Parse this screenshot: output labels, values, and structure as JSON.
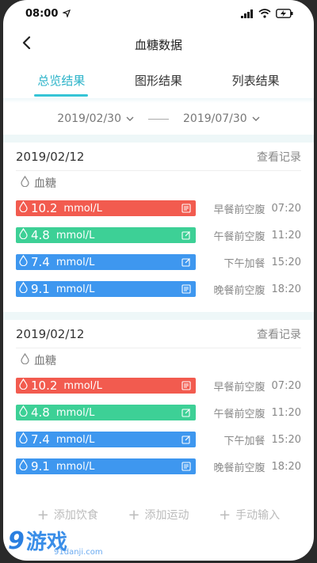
{
  "status": {
    "time": "08:00"
  },
  "nav": {
    "title": "血糖数据"
  },
  "tabs": [
    {
      "label": "总览结果",
      "active": true
    },
    {
      "label": "图形结果",
      "active": false
    },
    {
      "label": "列表结果",
      "active": false
    }
  ],
  "date_range": {
    "start": "2019/02/30",
    "end": "2019/07/30"
  },
  "cards": [
    {
      "date": "2019/02/12",
      "view_label": "查看记录",
      "category": "血糖",
      "readings": [
        {
          "value": "10.2",
          "unit": "mmol/L",
          "color": "#f25b4f",
          "action_icon": "document-icon",
          "meal": "早餐前空腹",
          "time": "07:20"
        },
        {
          "value": "4.8",
          "unit": "mmol/L",
          "color": "#3dd096",
          "action_icon": "edit-icon",
          "meal": "午餐前空腹",
          "time": "11:20"
        },
        {
          "value": "7.4",
          "unit": "mmol/L",
          "color": "#3e97ef",
          "action_icon": "edit-icon",
          "meal": "下午加餐",
          "time": "15:20"
        },
        {
          "value": "9.1",
          "unit": "mmol/L",
          "color": "#3e97ef",
          "action_icon": "document-icon",
          "meal": "晚餐前空腹",
          "time": "18:20"
        }
      ]
    },
    {
      "date": "2019/02/12",
      "view_label": "查看记录",
      "category": "血糖",
      "readings": [
        {
          "value": "10.2",
          "unit": "mmol/L",
          "color": "#f25b4f",
          "action_icon": "document-icon",
          "meal": "早餐前空腹",
          "time": "07:20"
        },
        {
          "value": "4.8",
          "unit": "mmol/L",
          "color": "#3dd096",
          "action_icon": "edit-icon",
          "meal": "午餐前空腹",
          "time": "11:20"
        },
        {
          "value": "7.4",
          "unit": "mmol/L",
          "color": "#3e97ef",
          "action_icon": "edit-icon",
          "meal": "下午加餐",
          "time": "15:20"
        },
        {
          "value": "9.1",
          "unit": "mmol/L",
          "color": "#3e97ef",
          "action_icon": "document-icon",
          "meal": "晚餐前空腹",
          "time": "18:20"
        }
      ]
    }
  ],
  "bottom_actions": [
    {
      "label": "添加饮食"
    },
    {
      "label": "添加运动"
    },
    {
      "label": "手动输入"
    }
  ],
  "watermark": {
    "logo": "9",
    "brand": "游戏",
    "url": "91danji.com"
  },
  "colors": {
    "accent": "#2bb3c9",
    "red": "#f25b4f",
    "green": "#3dd096",
    "blue": "#3e97ef"
  }
}
